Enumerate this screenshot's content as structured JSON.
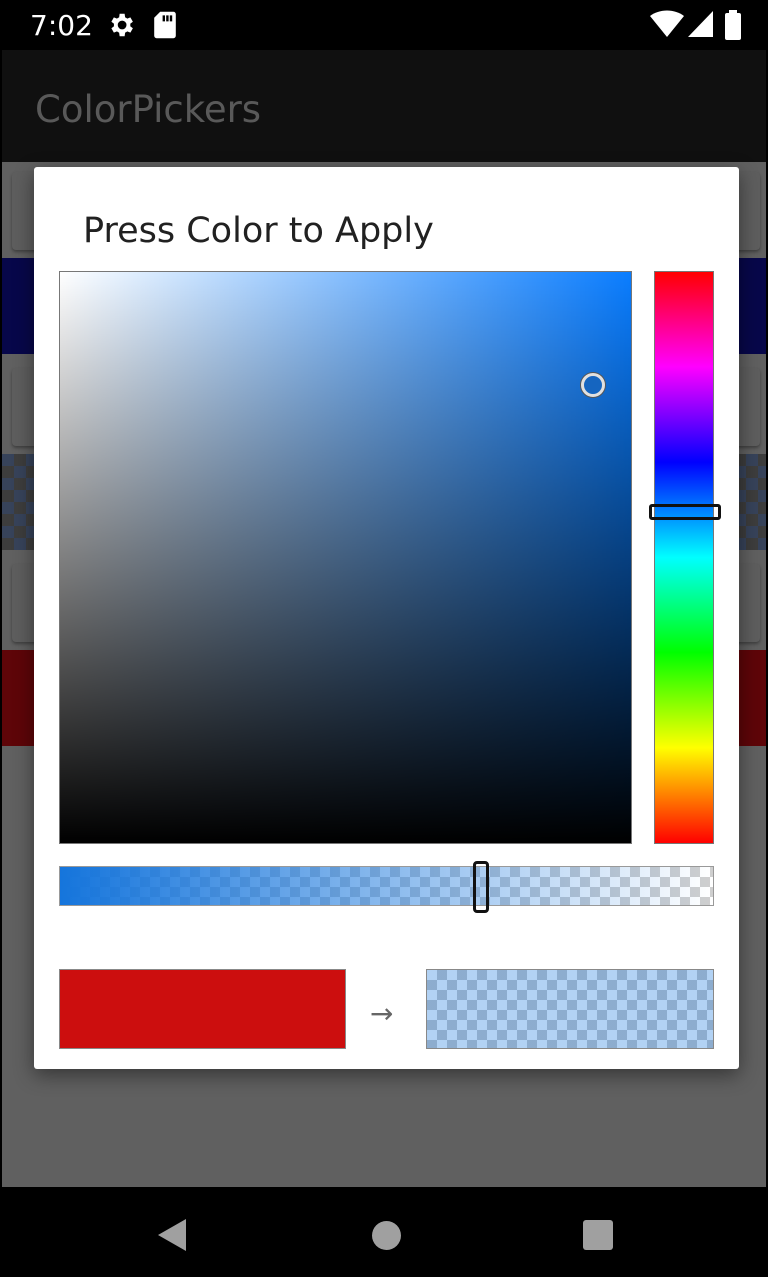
{
  "status_bar": {
    "time": "7:02",
    "icons": [
      "settings-icon",
      "sd-card-icon",
      "wifi-icon",
      "signal-icon",
      "battery-icon"
    ]
  },
  "app_bar": {
    "title": "ColorPickers"
  },
  "dialog": {
    "title": "Press Color to Apply",
    "arrow": "→",
    "hue_color": "#0a7dff",
    "old_color": "#cc0e0e",
    "new_color": "#1575dc",
    "alpha_level": 0.36
  },
  "background_swatches": [
    "#0a0a6e",
    "checkerboard",
    "#6e0a0a"
  ],
  "nav_bar": {
    "icons": [
      "back-icon",
      "home-icon",
      "recents-icon"
    ]
  }
}
